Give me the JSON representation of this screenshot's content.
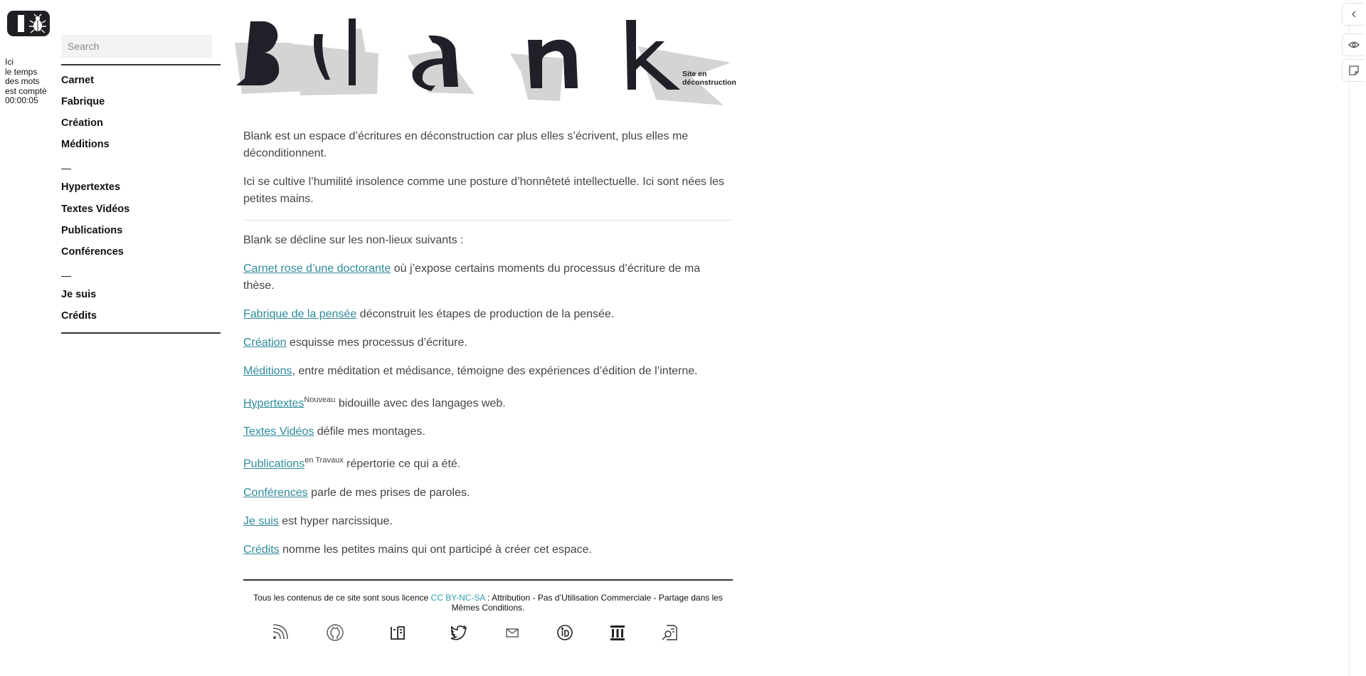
{
  "timer": {
    "line1": "Ici",
    "line2": "le temps",
    "line3": "des mots",
    "line4": "est compté",
    "time": "00:00:05"
  },
  "search": {
    "placeholder": "Search",
    "value": ""
  },
  "nav": {
    "group1": [
      "Carnet",
      "Fabrique",
      "Création",
      "Méditions"
    ],
    "separator": "—",
    "group2": [
      "Hypertextes",
      "Textes Vidéos",
      "Publications",
      "Conférences"
    ],
    "group3": [
      "Je suis",
      "Crédits"
    ]
  },
  "header": {
    "title": "Blank",
    "tagline_line1": "Site en",
    "tagline_line2": "déconstruction"
  },
  "intro": {
    "p1": "Blank est un espace d’écritures en déconstruction car plus elles s’écrivent, plus elles me déconditionnent.",
    "p2": "Ici se cultive l’humilité insolence comme une posture d’honnêteté intellectuelle. Ici sont nées les petites mains."
  },
  "list_intro": "Blank se décline sur les non-lieux suivants :",
  "sections": [
    {
      "link": "Carnet rose d’une doctorante",
      "sup": "",
      "text": " où j’expose certains moments du processus d’écriture de ma thèse."
    },
    {
      "link": "Fabrique de la pensée",
      "sup": "",
      "text": " déconstruit les étapes de production de la pensée."
    },
    {
      "link": "Création",
      "sup": "",
      "text": " esquisse mes processus d’écriture."
    },
    {
      "link": "Méditions",
      "sup": "",
      "text": ", entre méditation et médisance, témoigne des expériences d’édition de l’interne."
    },
    {
      "link": "Hypertextes",
      "sup": "Nouveau",
      "text": " bidouille avec des langages web."
    },
    {
      "link": "Textes Vidéos",
      "sup": "",
      "text": " défile mes montages."
    },
    {
      "link": "Publications",
      "sup": "en Travaux",
      "text": " répertorie ce qui a été."
    },
    {
      "link": "Conférences",
      "sup": "",
      "text": " parle de mes prises de paroles."
    },
    {
      "link": "Je suis",
      "sup": "",
      "text": " est hyper narcissique."
    },
    {
      "link": "Crédits",
      "sup": "",
      "text": " nomme les petites mains qui ont participé à créer cet espace."
    }
  ],
  "footer": {
    "license_prefix": "Tous les contenus de ce site sont sous licence ",
    "license_link": "CC BY-NC-SA",
    "license_suffix": " : Attribution - Pas d’Utilisation Commerciale - Partage dans les Mêmes Conditions."
  },
  "social_icons": [
    "rss-icon",
    "github-icon",
    "book-icon",
    "twitter-icon",
    "mail-icon",
    "orcid-icon",
    "institution-icon",
    "document-search-icon"
  ],
  "colors": {
    "link": "#2e8b9a",
    "license": "#2e9fb0",
    "logo_bg": "#1f1f24"
  }
}
